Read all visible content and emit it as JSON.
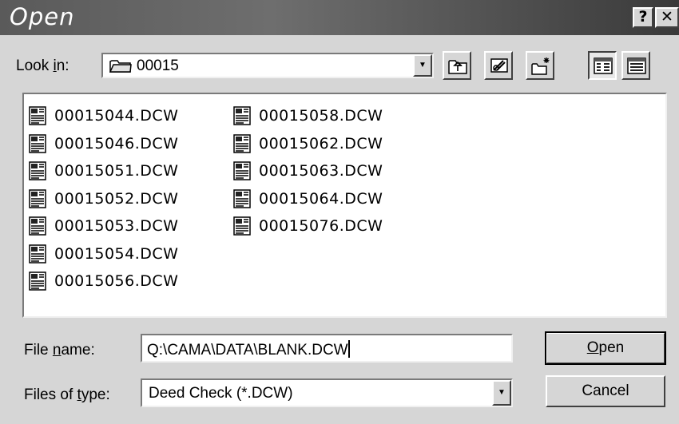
{
  "window": {
    "title": "Open",
    "help_glyph": "?",
    "close_glyph": "✕"
  },
  "lookin": {
    "label_pre": "Look ",
    "label_accel": "i",
    "label_post": "n:",
    "value": "00015",
    "icon": "folder-icon"
  },
  "toolbar": {
    "icons": [
      "up-one-level-icon",
      "desktop-icon",
      "new-folder-icon",
      "list-view-icon",
      "details-view-icon"
    ],
    "active_view": "list-view-icon"
  },
  "files": {
    "column1": [
      "00015044.DCW",
      "00015046.DCW",
      "00015051.DCW",
      "00015052.DCW",
      "00015053.DCW",
      "00015054.DCW",
      "00015056.DCW"
    ],
    "column2": [
      "00015058.DCW",
      "00015062.DCW",
      "00015063.DCW",
      "00015064.DCW",
      "00015076.DCW"
    ]
  },
  "filename": {
    "label_pre": "File ",
    "label_accel": "n",
    "label_post": "ame:",
    "value": "Q:\\CAMA\\DATA\\BLANK.DCW"
  },
  "filetype": {
    "label_pre": "Files of ",
    "label_accel": "t",
    "label_post": "ype:",
    "value": "Deed Check (*.DCW)"
  },
  "buttons": {
    "open_accel": "O",
    "open_rest": "pen",
    "cancel": "Cancel"
  },
  "colors": {
    "face": "#d6d6d6",
    "titlebar": "#5a5a5a"
  }
}
